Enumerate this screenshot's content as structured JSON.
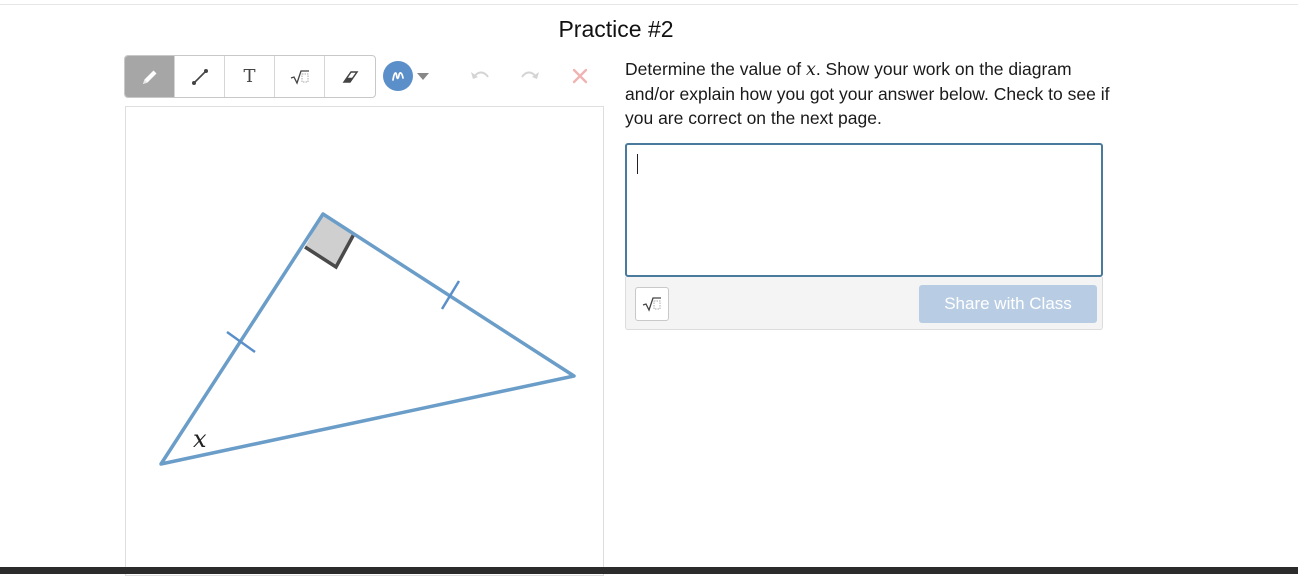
{
  "page": {
    "title": "Practice #2"
  },
  "toolbar": {
    "tools": [
      {
        "name": "pencil-icon",
        "active": true
      },
      {
        "name": "line-icon",
        "active": false
      },
      {
        "name": "text-tool-icon",
        "label": "T",
        "active": false
      },
      {
        "name": "math-icon",
        "active": false
      },
      {
        "name": "eraser-icon",
        "active": false
      }
    ],
    "color": "#5a8fc9",
    "actions": [
      "undo-icon",
      "redo-icon",
      "clear-icon"
    ]
  },
  "diagram": {
    "angle_label": "x",
    "line_color": "#6b9dc9",
    "right_angle_fill": "#cfcfcf"
  },
  "question": {
    "text_before": "Determine the value of ",
    "variable": "x",
    "text_after": ". Show your work on the diagram and/or explain how you got your answer below. Check to see if you are correct on the next page."
  },
  "response": {
    "value": "",
    "share_label": "Share with Class"
  }
}
